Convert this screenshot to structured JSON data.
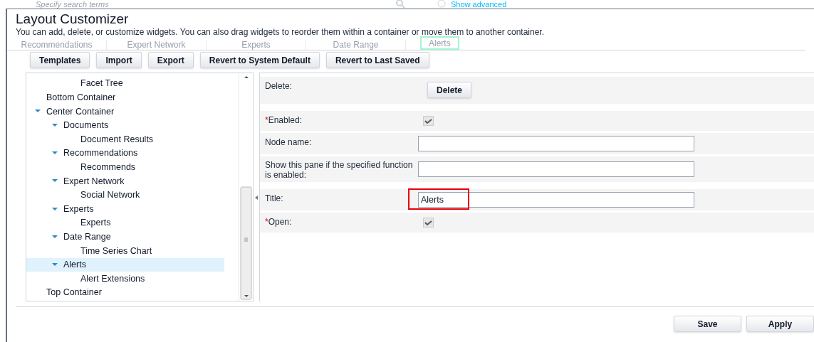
{
  "background": {
    "search": {
      "placeholder": "Specify search terms"
    },
    "show_advanced": "Show advanced",
    "tabs": [
      {
        "label": "Recommendations",
        "selected": false
      },
      {
        "label": "Expert Network",
        "selected": false
      },
      {
        "label": "Experts",
        "selected": false
      },
      {
        "label": "Date Range",
        "selected": false
      },
      {
        "label": "Alerts",
        "selected": true
      }
    ]
  },
  "dialog": {
    "title": "Layout Customizer",
    "description": "You can add, delete, or customize widgets. You can also drag widgets to reorder them within a container or move them to another container.",
    "toolbar": [
      "Templates",
      "Import",
      "Export",
      "Revert to System Default",
      "Revert to Last Saved"
    ],
    "tree": [
      {
        "children": [
          {
            "children": [
              {
                "label": "Facet Tree",
                "selected": false
              }
            ]
          }
        ]
      },
      {
        "label": "Bottom Container",
        "selected": false
      },
      {
        "label": "Center Container",
        "selected": false,
        "expanded": true,
        "children": [
          {
            "label": "Documents",
            "selected": false,
            "expanded": true,
            "children": [
              {
                "label": "Document Results",
                "selected": false
              }
            ]
          },
          {
            "label": "Recommendations",
            "selected": false,
            "expanded": true,
            "children": [
              {
                "label": "Recommends",
                "selected": false
              }
            ]
          },
          {
            "label": "Expert Network",
            "selected": false,
            "expanded": true,
            "children": [
              {
                "label": "Social Network",
                "selected": false
              }
            ]
          },
          {
            "label": "Experts",
            "selected": false,
            "expanded": true,
            "children": [
              {
                "label": "Experts",
                "selected": false
              }
            ]
          },
          {
            "label": "Date Range",
            "selected": false,
            "expanded": true,
            "children": [
              {
                "label": "Time Series Chart",
                "selected": false
              }
            ]
          },
          {
            "label": "Alerts",
            "selected": true,
            "expanded": true,
            "children": [
              {
                "label": "Alert Extensions",
                "selected": false
              }
            ]
          }
        ]
      },
      {
        "label": "Top Container",
        "selected": false
      }
    ],
    "sections": [
      [
        {
          "kind": "button",
          "label": "Delete:",
          "button": "Delete"
        }
      ],
      [
        {
          "kind": "checkbox",
          "required_mark": "*",
          "label": "Enabled:",
          "checked": true
        },
        {
          "kind": "field",
          "label": "Node name:"
        },
        {
          "kind": "field",
          "label": "Show this pane if the specified function is enabled:"
        }
      ],
      [
        {
          "kind": "field",
          "label": "Title:",
          "value": "Alerts",
          "highlighted": true
        },
        {
          "kind": "checkbox",
          "required_mark": "*",
          "label": "Open:",
          "checked": true
        }
      ]
    ],
    "footer": [
      "Save",
      "Apply"
    ]
  }
}
